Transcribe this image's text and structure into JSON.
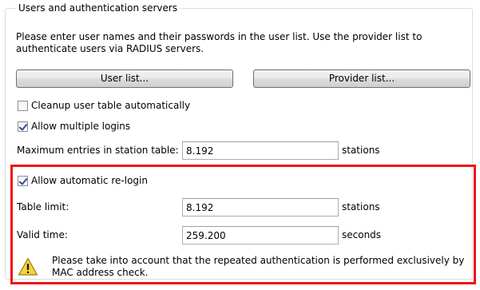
{
  "group": {
    "title": "Users and authentication servers",
    "description": "Please enter user names and their passwords in the user list. Use the provider list to authenticate users via RADIUS servers."
  },
  "buttons": {
    "user_list": "User list...",
    "provider_list": "Provider list..."
  },
  "checkboxes": {
    "cleanup": {
      "label": "Cleanup user table automatically",
      "checked": false
    },
    "multiple_logins": {
      "label": "Allow multiple logins",
      "checked": true
    },
    "auto_relogin": {
      "label": "Allow automatic re-login",
      "checked": true
    }
  },
  "fields": {
    "max_entries": {
      "label": "Maximum entries in station table:",
      "value": "8.192",
      "unit": "stations"
    },
    "table_limit": {
      "label": "Table limit:",
      "value": "8.192",
      "unit": "stations"
    },
    "valid_time": {
      "label": "Valid time:",
      "value": "259.200",
      "unit": "seconds"
    }
  },
  "warning": {
    "icon": "warning-icon",
    "text": "Please take into account that the repeated authentication is performed exclusively by MAC address check."
  },
  "colors": {
    "highlight": "#ee1111",
    "checkmark": "#2f4f9a",
    "warning_fill": "#f5d33a"
  }
}
